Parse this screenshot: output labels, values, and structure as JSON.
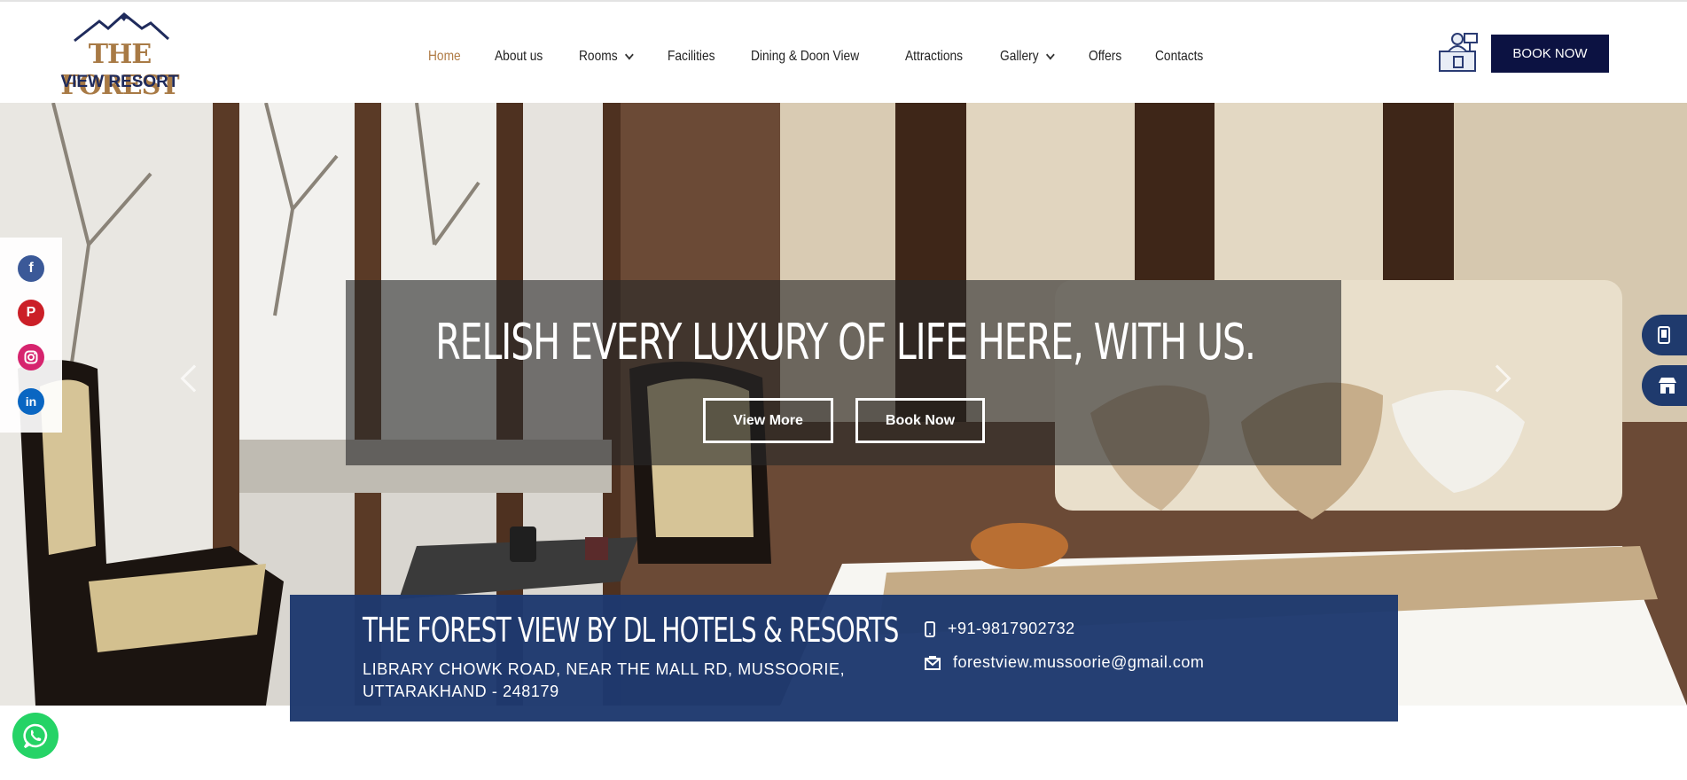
{
  "brand": {
    "line1": "THE FOREST",
    "line2": "VIEW RESORT",
    "color_gold": "#a87a45",
    "color_navy": "#1f2b5c"
  },
  "nav": {
    "items": [
      {
        "label": "Home",
        "active": true,
        "dropdown": false
      },
      {
        "label": "About us",
        "active": false,
        "dropdown": false
      },
      {
        "label": "Rooms",
        "active": false,
        "dropdown": true
      },
      {
        "label": "Facilities",
        "active": false,
        "dropdown": false
      },
      {
        "label": "Dining & Doon View",
        "active": false,
        "dropdown": false
      },
      {
        "label": "Attractions",
        "active": false,
        "dropdown": false
      },
      {
        "label": "Gallery",
        "active": false,
        "dropdown": true
      },
      {
        "label": "Offers",
        "active": false,
        "dropdown": false
      },
      {
        "label": "Contacts",
        "active": false,
        "dropdown": false
      }
    ]
  },
  "header": {
    "book_label": "BOOK NOW",
    "reception_icon": "reception-desk-icon",
    "book_color": "#0c1242"
  },
  "hero": {
    "caption": "RELISH EVERY LUXURY OF LIFE HERE, WITH US.",
    "view_more_label": "View More",
    "book_now_label": "Book Now"
  },
  "social": [
    "facebook-icon",
    "pinterest-icon",
    "instagram-icon",
    "linkedin-icon"
  ],
  "right_tabs": [
    "mobile-phone-icon",
    "store-icon"
  ],
  "info": {
    "title": "THE FOREST VIEW BY DL HOTELS & RESORTS",
    "address": "LIBRARY CHOWK ROAD, NEAR THE MALL RD, MUSSOORIE, UTTARAKHAND - 248179",
    "phone": "+91-9817902732",
    "email": "forestview.mussoorie@gmail.com",
    "background": "#1e396e"
  },
  "whatsapp": {
    "icon": "whatsapp-icon",
    "color": "#25d366"
  }
}
